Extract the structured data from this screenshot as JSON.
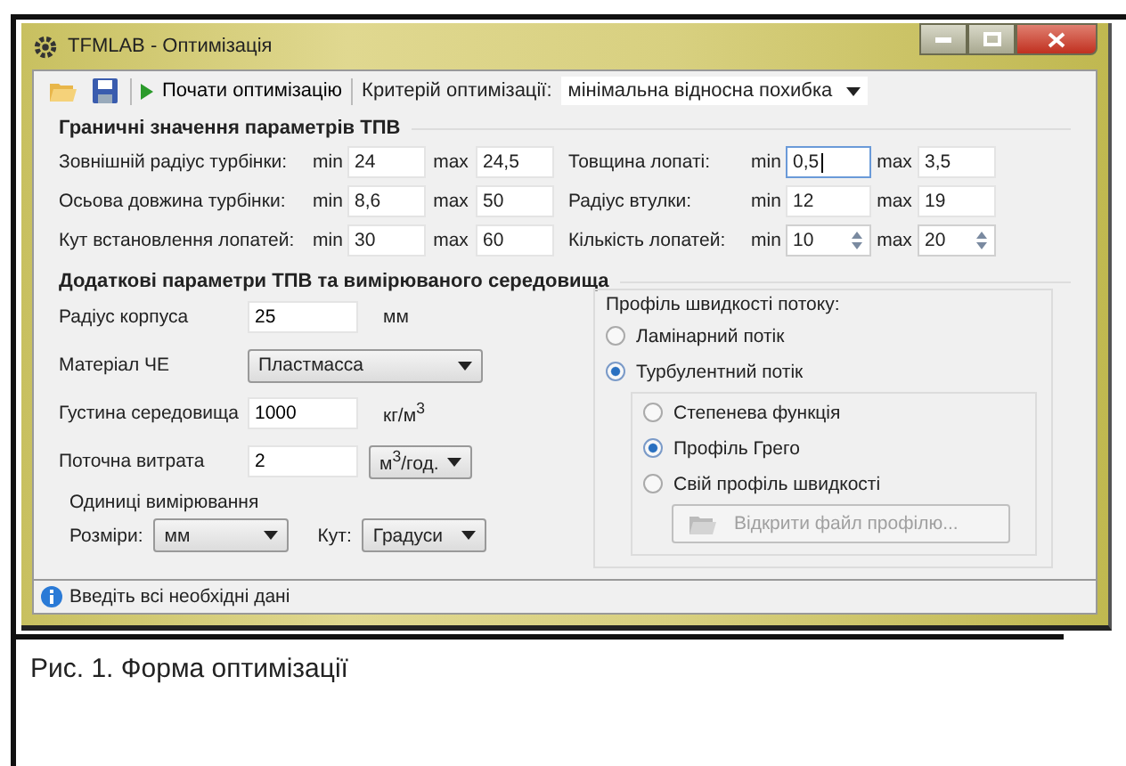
{
  "window": {
    "title": "TFMLAB - Оптимізація"
  },
  "toolbar": {
    "start": "Почати оптимізацію",
    "criterion_label": "Критерій оптимізації:",
    "criterion_value": "мінімальна відносна похибка"
  },
  "limits": {
    "title": "Граничні значення параметрів ТПВ",
    "rows": [
      {
        "left": {
          "label": "Зовнішній радіус турбінки:",
          "min_label": "min",
          "min": "24",
          "max_label": "max",
          "max": "24,5",
          "kind": "text",
          "focused": false
        },
        "right": {
          "label": "Товщина лопаті:",
          "min_label": "min",
          "min": "0,5",
          "max_label": "max",
          "max": "3,5",
          "kind": "text",
          "focused": true
        }
      },
      {
        "left": {
          "label": "Осьова довжина турбінки:",
          "min_label": "min",
          "min": "8,6",
          "max_label": "max",
          "max": "50",
          "kind": "text",
          "focused": false
        },
        "right": {
          "label": "Радіус втулки:",
          "min_label": "min",
          "min": "12",
          "max_label": "max",
          "max": "19",
          "kind": "text",
          "focused": false
        }
      },
      {
        "left": {
          "label": "Кут встановлення лопатей:",
          "min_label": "min",
          "min": "30",
          "max_label": "max",
          "max": "60",
          "kind": "text",
          "focused": false
        },
        "right": {
          "label": "Кількість лопатей:",
          "min_label": "min",
          "min": "10",
          "max_label": "max",
          "max": "20",
          "kind": "spin",
          "focused": false
        }
      }
    ]
  },
  "extra": {
    "title": "Додаткові параметри ТПВ та вимірюваного середовища",
    "fields": [
      {
        "label": "Радіус корпуса",
        "kind": "text",
        "value": "25",
        "unit": {
          "kind": "text",
          "label": "мм"
        }
      },
      {
        "label": "Матеріал ЧЕ",
        "kind": "select",
        "value": "Пластмасса"
      },
      {
        "label": "Густина середовища",
        "kind": "text",
        "value": "1000",
        "unit": {
          "kind": "text",
          "label": "кг/м$^{3}$"
        }
      },
      {
        "label": "Поточна витрата",
        "kind": "text",
        "value": "2",
        "unit": {
          "kind": "select",
          "label": "м$^{3}$/год."
        }
      }
    ],
    "units": {
      "title": "Одиниці вимірювання",
      "size_label": "Розміри:",
      "size_value": "мм",
      "angle_label": "Кут:",
      "angle_value": "Градуси"
    },
    "profile": {
      "title": "Профіль швидкості потоку:",
      "options": [
        {
          "label": "Ламінарний потік",
          "selected": false
        },
        {
          "label": "Турбулентний потік",
          "selected": true,
          "children": [
            {
              "label": "Степенева функція",
              "selected": false
            },
            {
              "label": "Профіль Грего",
              "selected": true
            },
            {
              "label": "Свій профіль швидкості",
              "selected": false
            }
          ]
        }
      ],
      "open_button": {
        "label": "Відкрити файл профілю...",
        "disabled": true
      }
    }
  },
  "status_bar": {
    "text": "Введіть всі необхідні дані"
  },
  "caption": "Рис. 1. Форма оптимізації"
}
